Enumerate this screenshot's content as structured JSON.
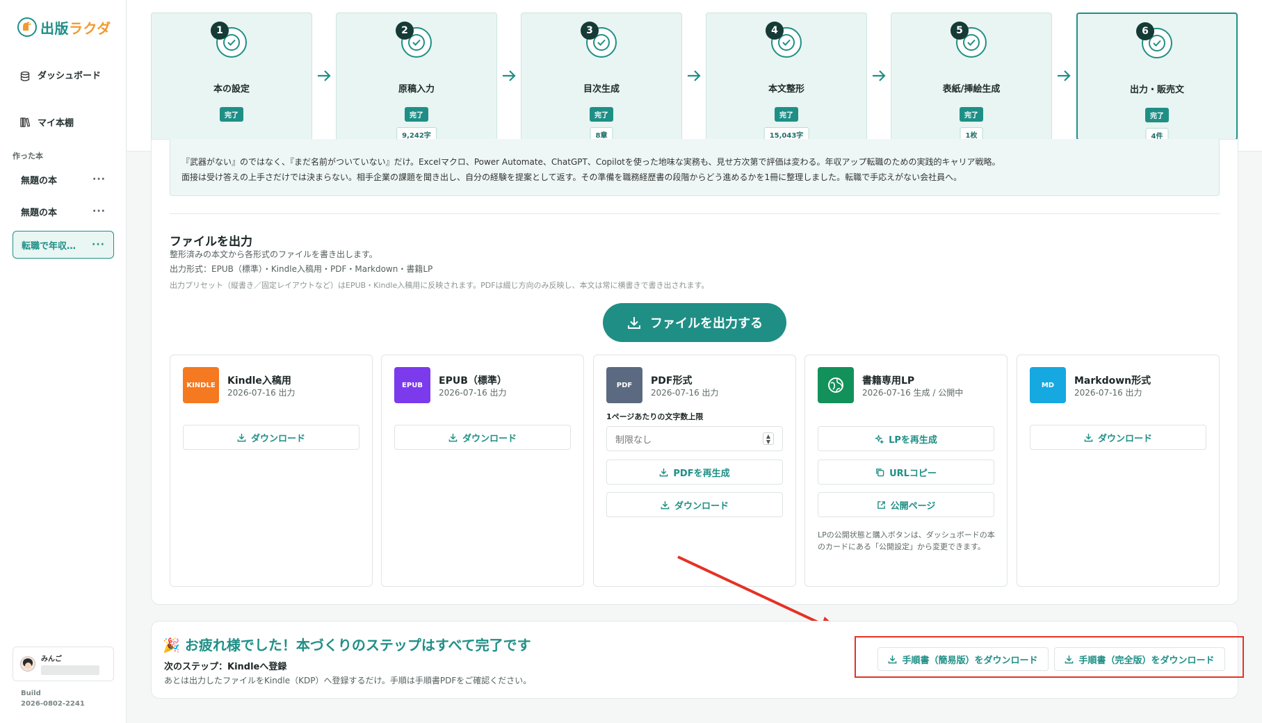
{
  "app": {
    "name_part1": "出版",
    "name_part2": "ラクダ"
  },
  "sidebar": {
    "nav": [
      {
        "label": "ダッシュボード",
        "icon": "database-icon"
      },
      {
        "label": "マイ本棚",
        "icon": "bookshelf-icon"
      }
    ],
    "section_label": "作った本",
    "books": [
      {
        "title": "無題の本",
        "active": false
      },
      {
        "title": "無題の本",
        "active": false
      },
      {
        "title": "転職で年収…",
        "active": true
      }
    ],
    "more_label": "···",
    "user": {
      "name": "みんご"
    },
    "build_label": "Build",
    "build_version": "2026-0802-2241"
  },
  "steps": [
    {
      "num": "1",
      "name": "本の設定",
      "badge": "完了",
      "meta": ""
    },
    {
      "num": "2",
      "name": "原稿入力",
      "badge": "完了",
      "meta": "9,242字"
    },
    {
      "num": "3",
      "name": "目次生成",
      "badge": "完了",
      "meta": "8章"
    },
    {
      "num": "4",
      "name": "本文整形",
      "badge": "完了",
      "meta": "15,043字"
    },
    {
      "num": "5",
      "name": "表紙/挿絵生成",
      "badge": "完了",
      "meta": "1枚"
    },
    {
      "num": "6",
      "name": "出力・販売文",
      "badge": "完了",
      "meta": "4件"
    }
  ],
  "description": {
    "line1": "『武器がない』のではなく、『まだ名前がついていない』だけ。Excelマクロ、Power Automate、ChatGPT、Copilotを使った地味な実務も、見せ方次第で評価は変わる。年収アップ転職のための実践的キャリア戦略。",
    "line2": "面接は受け答えの上手さだけでは決まらない。相手企業の課題を聞き出し、自分の経験を提案として返す。その準備を職務経歴書の段階からどう進めるかを1冊に整理しました。転職で手応えがない会社員へ。"
  },
  "output": {
    "title": "ファイルを出力",
    "subtitle": "整形済みの本文から各形式のファイルを書き出します。",
    "formats": "出力形式：EPUB（標準）・Kindle入稿用・PDF・Markdown・書籍LP",
    "note": "出力プリセット（縦書き／固定レイアウトなど）はEPUB・Kindle入稿用に反映されます。PDFは綴じ方向のみ反映し、本文は常に横書きで書き出されます。",
    "export_button": "ファイルを出力する"
  },
  "files": [
    {
      "name": "Kindle入稿用",
      "date": "2026-07-16 出力",
      "icon_text": "KINDLE",
      "color": "#f47920",
      "download": "ダウンロード"
    },
    {
      "name": "EPUB（標準）",
      "date": "2026-07-16 出力",
      "icon_text": "EPUB",
      "color": "#7c3aed",
      "download": "ダウンロード"
    },
    {
      "name": "PDF形式",
      "date": "2026-07-16 出力",
      "icon_text": "PDF",
      "color": "#5b6a80",
      "limit_label": "1ページあたりの文字数上限",
      "limit_value": "制限なし",
      "regen": "PDFを再生成",
      "download": "ダウンロード"
    },
    {
      "name": "書籍専用LP",
      "date": "2026-07-16 生成 / 公開中",
      "icon_text": "",
      "color": "#12915a",
      "regen": "LPを再生成",
      "copy": "URLコピー",
      "open": "公開ページ",
      "note": "LPの公開状態と購入ボタンは、ダッシュボードの本のカードにある「公開設定」から変更できます。"
    },
    {
      "name": "Markdown形式",
      "date": "2026-07-16 出力",
      "icon_text": "MD",
      "color": "#16a8e0",
      "download": "ダウンロード"
    }
  ],
  "completion": {
    "emoji": "🎉",
    "title": "お疲れ様でした！本づくりのステップはすべて完了です",
    "next": "次のステップ：Kindleへ登録",
    "desc": "あとは出力したファイルをKindle（KDP）へ登録するだけ。手順は手順書PDFをご確認ください。",
    "btn_simple": "手順書（簡易版）をダウンロード",
    "btn_full": "手順書（完全版）をダウンロード"
  },
  "colors": {
    "accent": "#1f8f86",
    "highlight": "#e53224",
    "step_bg": "#e8f5f2"
  }
}
